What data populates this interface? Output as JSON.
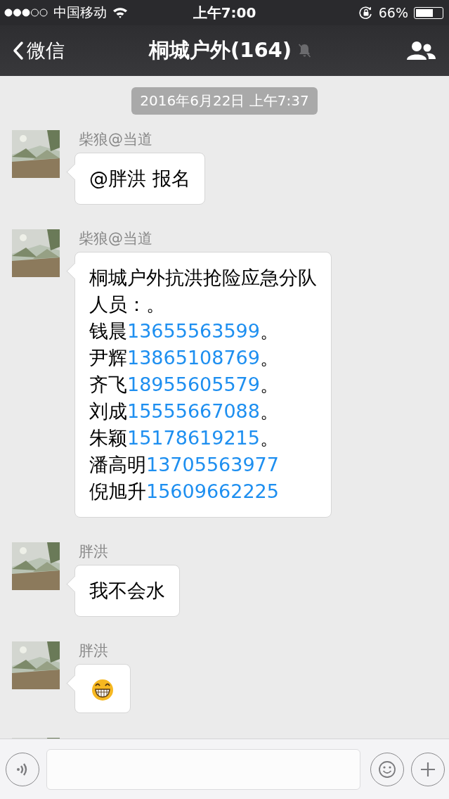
{
  "status_bar": {
    "carrier": "中国移动",
    "time": "上午7:00",
    "battery": "66%"
  },
  "nav": {
    "back": "微信",
    "title": "桐城户外(164)",
    "muted": true
  },
  "timestamp": "2016年6月22日 上午7:37",
  "messages": [
    {
      "kind": "text",
      "sender": "柴狼@当道",
      "lines": [
        [
          {
            "kind": "plain",
            "text": "@胖洪 报名"
          }
        ]
      ]
    },
    {
      "kind": "text",
      "sender": "柴狼@当道",
      "lines": [
        [
          {
            "kind": "plain",
            "text": "桐城户外抗洪抢险应急分队"
          }
        ],
        [
          {
            "kind": "plain",
            "text": "人员：。"
          }
        ],
        [
          {
            "kind": "plain",
            "text": "钱晨"
          },
          {
            "kind": "link",
            "text": "13655563599"
          },
          {
            "kind": "plain",
            "text": "。"
          }
        ],
        [
          {
            "kind": "plain",
            "text": "尹辉"
          },
          {
            "kind": "link",
            "text": "13865108769"
          },
          {
            "kind": "plain",
            "text": "。"
          }
        ],
        [
          {
            "kind": "plain",
            "text": "齐飞"
          },
          {
            "kind": "link",
            "text": "18955605579"
          },
          {
            "kind": "plain",
            "text": "。"
          }
        ],
        [
          {
            "kind": "plain",
            "text": "刘成"
          },
          {
            "kind": "link",
            "text": "15555667088"
          },
          {
            "kind": "plain",
            "text": "。"
          }
        ],
        [
          {
            "kind": "plain",
            "text": "朱颖"
          },
          {
            "kind": "link",
            "text": "15178619215"
          },
          {
            "kind": "plain",
            "text": "。"
          }
        ],
        [
          {
            "kind": "plain",
            "text": "潘高明"
          },
          {
            "kind": "link",
            "text": "13705563977"
          }
        ],
        [
          {
            "kind": "plain",
            "text": "倪旭升"
          },
          {
            "kind": "link",
            "text": "15609662225"
          }
        ]
      ]
    },
    {
      "kind": "text",
      "sender": "胖洪",
      "lines": [
        [
          {
            "kind": "plain",
            "text": "我不会水"
          }
        ]
      ]
    },
    {
      "kind": "emoji",
      "sender": "胖洪"
    },
    {
      "kind": "cut"
    }
  ]
}
